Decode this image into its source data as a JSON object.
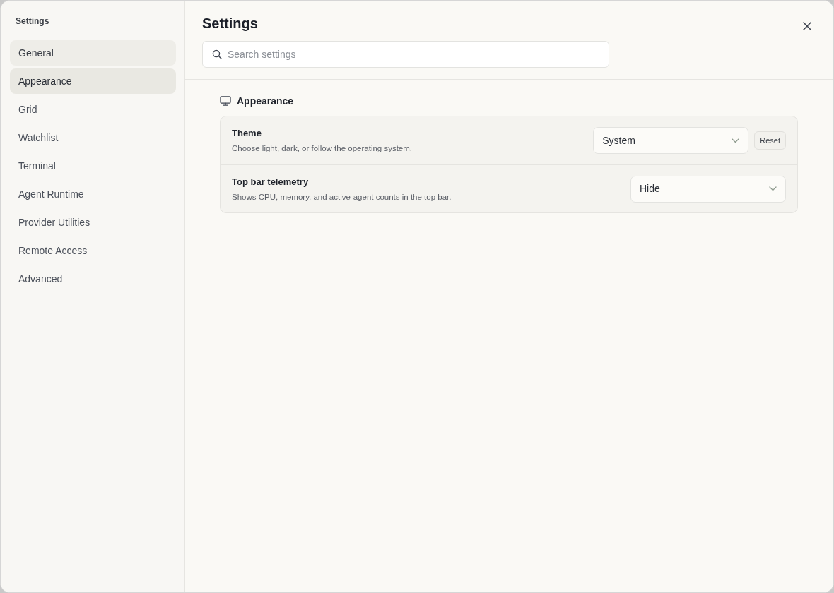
{
  "sidebar": {
    "title": "Settings",
    "items": [
      {
        "label": "General",
        "selected": false,
        "hovered": true
      },
      {
        "label": "Appearance",
        "selected": true,
        "hovered": false
      },
      {
        "label": "Grid",
        "selected": false,
        "hovered": false
      },
      {
        "label": "Watchlist",
        "selected": false,
        "hovered": false
      },
      {
        "label": "Terminal",
        "selected": false,
        "hovered": false
      },
      {
        "label": "Agent Runtime",
        "selected": false,
        "hovered": false
      },
      {
        "label": "Provider Utilities",
        "selected": false,
        "hovered": false
      },
      {
        "label": "Remote Access",
        "selected": false,
        "hovered": false
      },
      {
        "label": "Advanced",
        "selected": false,
        "hovered": false
      }
    ]
  },
  "header": {
    "title": "Settings",
    "search": {
      "placeholder": "Search settings"
    }
  },
  "section": {
    "title": "Appearance",
    "rows": [
      {
        "title": "Theme",
        "description": "Choose light, dark, or follow the operating system.",
        "control": {
          "kind": "select",
          "value": "System"
        },
        "reset_button": "Reset"
      },
      {
        "title": "Top bar telemetry",
        "description": "Shows CPU, memory, and active-agent counts in the top bar.",
        "control": {
          "kind": "select",
          "value": "Hide"
        }
      }
    ]
  }
}
